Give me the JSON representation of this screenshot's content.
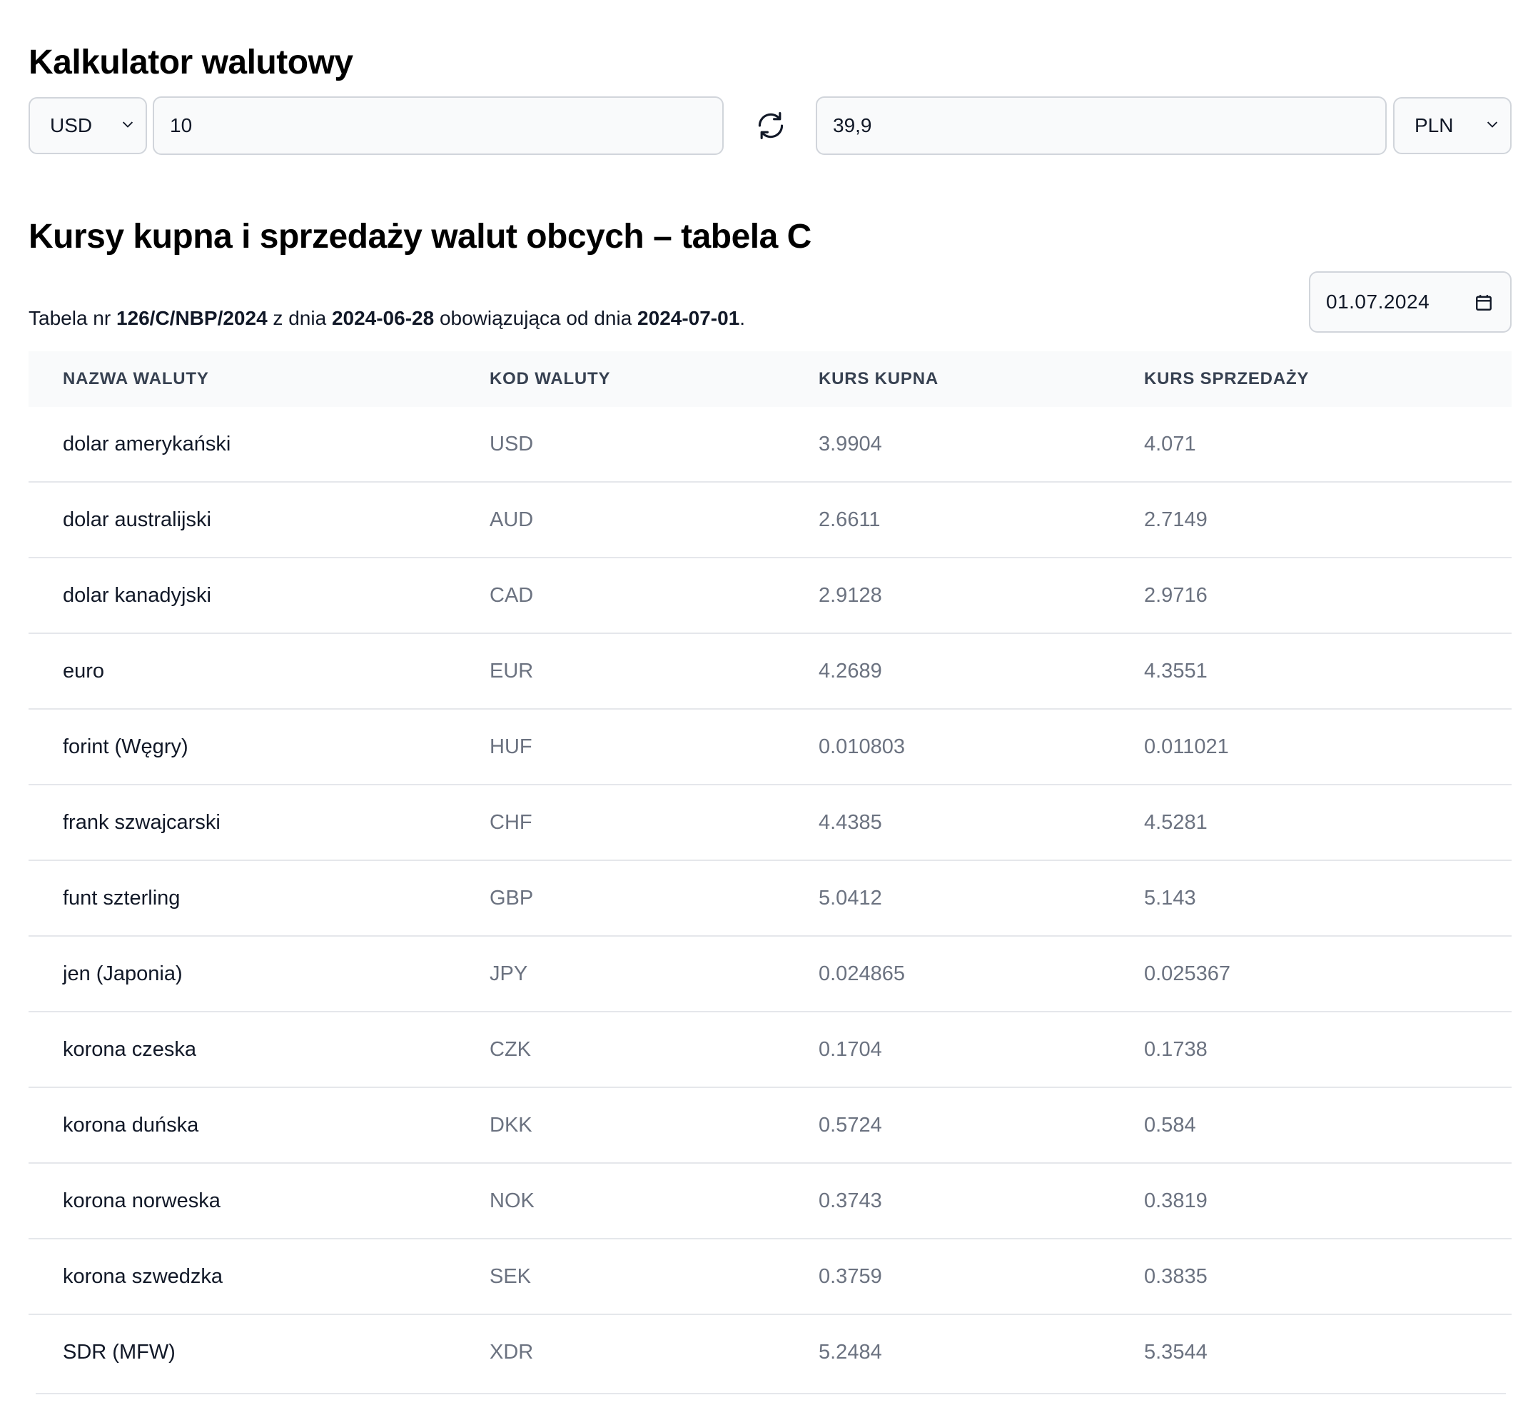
{
  "calculator": {
    "title": "Kalkulator walutowy",
    "from_currency": "USD",
    "from_amount": "10",
    "to_amount": "39,9",
    "to_currency": "PLN"
  },
  "rates": {
    "title": "Kursy kupna i sprzedaży walut obcych – tabela C",
    "date_value": "01.07.2024",
    "info": {
      "prefix": "Tabela nr ",
      "table_no": "126/C/NBP/2024",
      "mid1": " z dnia ",
      "publication_date": "2024-06-28",
      "mid2": " obowiązująca od dnia ",
      "effective_date": "2024-07-01",
      "suffix": "."
    },
    "headers": [
      "NAZWA WALUTY",
      "KOD WALUTY",
      "KURS KUPNA",
      "KURS SPRZEDAŻY"
    ],
    "rows": [
      {
        "name": "dolar amerykański",
        "code": "USD",
        "bid": "3.9904",
        "ask": "4.071"
      },
      {
        "name": "dolar australijski",
        "code": "AUD",
        "bid": "2.6611",
        "ask": "2.7149"
      },
      {
        "name": "dolar kanadyjski",
        "code": "CAD",
        "bid": "2.9128",
        "ask": "2.9716"
      },
      {
        "name": "euro",
        "code": "EUR",
        "bid": "4.2689",
        "ask": "4.3551"
      },
      {
        "name": "forint (Węgry)",
        "code": "HUF",
        "bid": "0.010803",
        "ask": "0.011021"
      },
      {
        "name": "frank szwajcarski",
        "code": "CHF",
        "bid": "4.4385",
        "ask": "4.5281"
      },
      {
        "name": "funt szterling",
        "code": "GBP",
        "bid": "5.0412",
        "ask": "5.143"
      },
      {
        "name": "jen (Japonia)",
        "code": "JPY",
        "bid": "0.024865",
        "ask": "0.025367"
      },
      {
        "name": "korona czeska",
        "code": "CZK",
        "bid": "0.1704",
        "ask": "0.1738"
      },
      {
        "name": "korona duńska",
        "code": "DKK",
        "bid": "0.5724",
        "ask": "0.584"
      },
      {
        "name": "korona norweska",
        "code": "NOK",
        "bid": "0.3743",
        "ask": "0.3819"
      },
      {
        "name": "korona szwedzka",
        "code": "SEK",
        "bid": "0.3759",
        "ask": "0.3835"
      },
      {
        "name": "SDR (MFW)",
        "code": "XDR",
        "bid": "5.2484",
        "ask": "5.3544"
      }
    ]
  },
  "icons": {
    "swap": "refresh-arrows-icon",
    "select_arrow": "chevron-down-icon",
    "date": "calendar-icon"
  }
}
